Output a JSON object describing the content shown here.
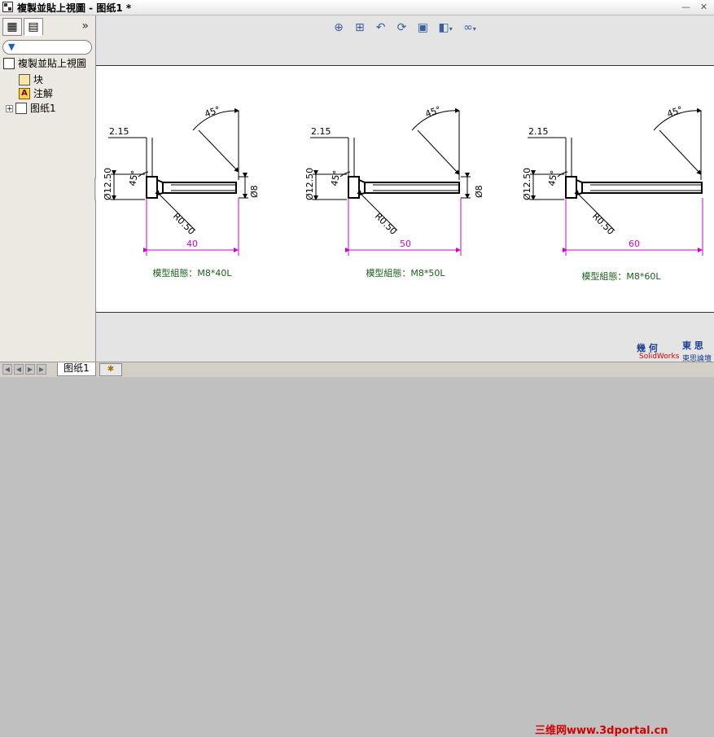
{
  "window": {
    "title": "複製並貼上視圖 - 图纸1 *"
  },
  "feature_manager": {
    "more": "»",
    "tree": {
      "root": "複製並貼上視圖",
      "items": [
        {
          "label": "块"
        },
        {
          "label": "注解"
        },
        {
          "label": "图纸1"
        }
      ]
    }
  },
  "toolbar": {
    "icons": [
      "zoom-to-fit-icon",
      "zoom-area-icon",
      "previous-view-icon",
      "rotate-icon",
      "redraw-icon",
      "display-style-icon",
      "hide-show-items-icon"
    ]
  },
  "views": [
    {
      "label": "模型組態：M8*40L",
      "length": "40",
      "chamfer_leader": "2.15",
      "angle_top": "45°",
      "angle_side": "45°",
      "head_dia": "Ø12.50",
      "shank_dia": "Ø8",
      "radius": "R0.50"
    },
    {
      "label": "模型組態：M8*50L",
      "length": "50",
      "chamfer_leader": "2.15",
      "angle_top": "45°",
      "angle_side": "45°",
      "head_dia": "Ø12.50",
      "shank_dia": "Ø8",
      "radius": "R0.50"
    },
    {
      "label": "模型組態：M8*60L",
      "length": "60",
      "chamfer_leader": "2.15",
      "angle_top": "45°",
      "angle_side": "45°",
      "head_dia": "Ø12.50",
      "shank_dia": "Ø8",
      "radius": "R0.50"
    }
  ],
  "status": {
    "sheet_tab": "图纸1"
  },
  "watermark": {
    "brand_a": "幾 何",
    "brand_b": "東 思",
    "sub_a": "SolidWorks",
    "sub_b": "東思論壇",
    "url": "三维网www.3dportal.cn"
  },
  "colors": {
    "dimension": "#d000d0",
    "annotation_text": "#1a5e1a",
    "geometry": "#000000",
    "sheet": "#ffffff"
  }
}
